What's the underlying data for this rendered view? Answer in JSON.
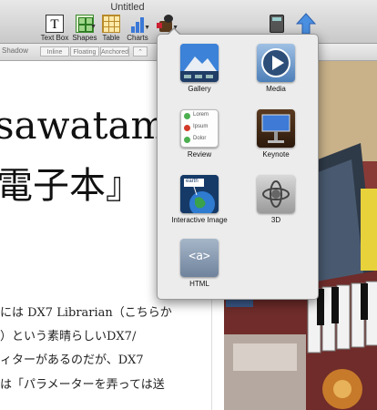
{
  "window": {
    "title": "Untitled"
  },
  "toolbar": {
    "items": [
      {
        "label": "Text Box",
        "icon": "text-box-icon"
      },
      {
        "label": "Shapes",
        "icon": "shapes-icon"
      },
      {
        "label": "Table",
        "icon": "table-icon"
      },
      {
        "label": "Charts",
        "icon": "charts-icon"
      },
      {
        "label": "",
        "icon": "media-icon"
      }
    ],
    "right_icons": [
      "calculator-icon",
      "upload-icon"
    ]
  },
  "format_bar": {
    "shadow_label": "Shadow",
    "wrap_buttons": [
      "Inline",
      "Floating",
      "Anchored"
    ]
  },
  "document": {
    "heading_line1": "sawatami",
    "heading_line2": "電子本』",
    "body_lines": [
      "には DX7 Librarian（こちらか",
      "）という素晴らしいDX7/",
      "ィターがあるのだが、DX7",
      "は「パラメーターを弄っては送"
    ]
  },
  "insert_menu": {
    "items": [
      {
        "label": "Gallery",
        "icon": "gallery-icon"
      },
      {
        "label": "Media",
        "icon": "media-play-icon"
      },
      {
        "label": "Review",
        "icon": "review-icon",
        "review_lines": [
          "Lorem",
          "Ipsum",
          "Dolor"
        ]
      },
      {
        "label": "Keynote",
        "icon": "keynote-icon"
      },
      {
        "label": "Interactive Image",
        "icon": "interactive-image-icon",
        "thumb_text": "earth"
      },
      {
        "label": "3D",
        "icon": "3d-icon"
      },
      {
        "label": "HTML",
        "icon": "html-icon",
        "thumb_text": "<a>"
      }
    ]
  },
  "colors": {
    "accent_blue": "#3a78d8",
    "review_green": "#4caf50",
    "review_red": "#d23a2a"
  }
}
